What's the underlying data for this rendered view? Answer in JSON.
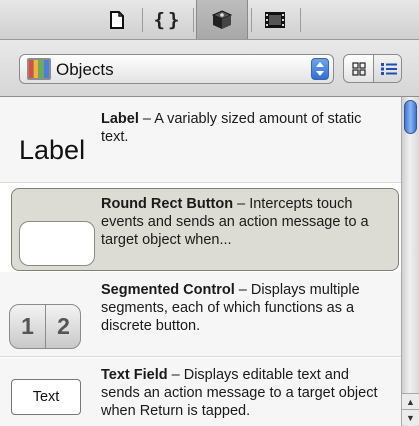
{
  "tabs": [
    {
      "name": "file-icon",
      "selected": false
    },
    {
      "name": "braces-icon",
      "glyph": "{}",
      "selected": false
    },
    {
      "name": "cube-icon",
      "selected": true
    },
    {
      "name": "film-icon",
      "selected": false
    }
  ],
  "filter": {
    "selected": "Objects",
    "icon": "library-books-icon"
  },
  "view_mode": {
    "options": [
      "grid-view-icon",
      "list-view-icon"
    ],
    "selected": "list-view-icon"
  },
  "items": [
    {
      "title": "Label",
      "description": " – A variably sized amount of static text.",
      "preview_text": "Label",
      "selected": false
    },
    {
      "title": "Round Rect Button",
      "description": " – Intercepts touch events and sends an action message to a target object when...",
      "selected": true
    },
    {
      "title": "Segmented Control",
      "description": " – Displays multiple segments, each of which functions as a discrete button.",
      "segments": [
        "1",
        "2"
      ],
      "selected": false
    },
    {
      "title": "Text Field",
      "description": " – Displays editable text and sends an action message to a target object when Return is tapped.",
      "preview_text": "Text",
      "selected": false
    }
  ],
  "scrollbar": {
    "up_glyph": "▲",
    "down_glyph": "▼"
  },
  "colors": {
    "accent": "#3f74d0",
    "selection": "#dcdcd4"
  }
}
